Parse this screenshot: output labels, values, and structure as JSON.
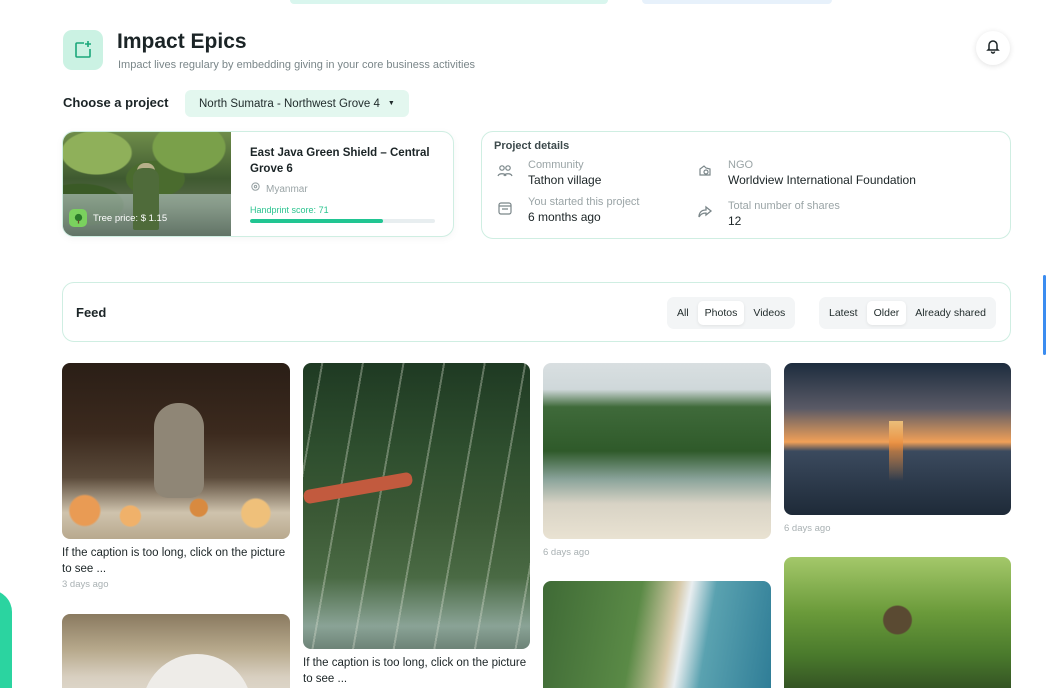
{
  "header": {
    "title": "Impact Epics",
    "subtitle": "Impact lives regulary by embedding giving in your core business activities"
  },
  "project_picker": {
    "label": "Choose a project",
    "selected": "North Sumatra - Northwest Grove 4"
  },
  "project_card": {
    "title": "East Java Green Shield – Central Grove 6",
    "location": "Myanmar",
    "tree_price": "Tree price: $ 1.15",
    "handprint_label": "Handprint score:",
    "handprint_value": "71",
    "handprint_fraction": 0.72
  },
  "project_details": {
    "title": "Project details",
    "items": [
      {
        "label": "Community",
        "value": "Tathon village",
        "icon": "community-icon"
      },
      {
        "label": "NGO",
        "value": "Worldview International Foundation",
        "icon": "ngo-icon"
      },
      {
        "label": "You started this project",
        "value": "6 months ago",
        "icon": "calendar-icon"
      },
      {
        "label": "Total number of shares",
        "value": "12",
        "icon": "share-icon"
      }
    ]
  },
  "feed": {
    "title": "Feed",
    "type_filters": [
      "All",
      "Photos",
      "Videos"
    ],
    "type_active": "Photos",
    "sort_filters": [
      "Latest",
      "Older",
      "Already shared"
    ],
    "sort_active": "Older"
  },
  "posts": [
    {
      "image": "monkey",
      "caption": "If the caption is too long, click on the picture to see ...",
      "time": "3 days ago"
    },
    {
      "image": "mangrove",
      "caption": "If the caption is too long, click on the picture to see ...",
      "time": ""
    },
    {
      "image": "beach",
      "caption": "",
      "time": "6 days ago"
    },
    {
      "image": "sunset",
      "caption": "",
      "time": "6 days ago"
    },
    {
      "image": "elder",
      "caption": "",
      "time": ""
    },
    {
      "image": "aerial-coast",
      "caption": "",
      "time": ""
    },
    {
      "image": "banyan-tree",
      "caption": "",
      "time": ""
    }
  ],
  "colors": {
    "accent": "#21c592",
    "accent_light": "#e3f7ef",
    "border": "#cfeee2"
  }
}
